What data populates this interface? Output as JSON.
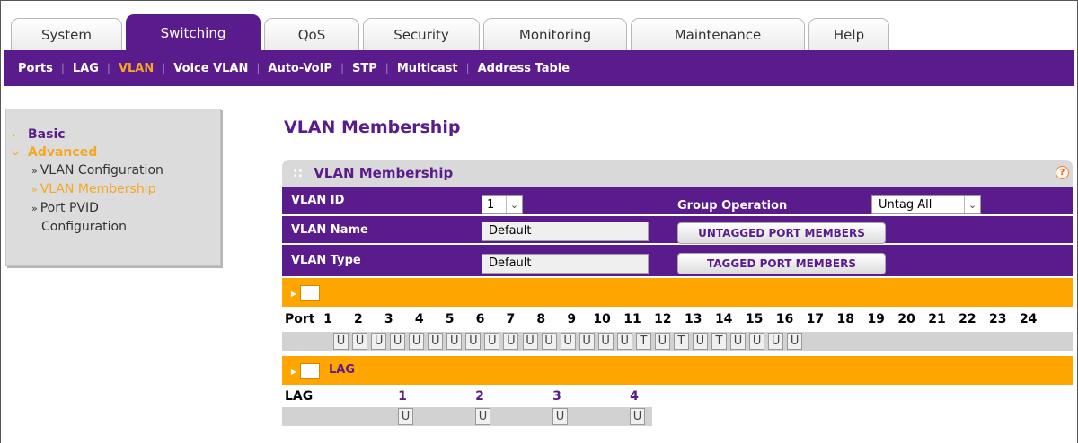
{
  "tabs": [
    {
      "label": "System",
      "active": false
    },
    {
      "label": "Switching",
      "active": true
    },
    {
      "label": "QoS",
      "active": false
    },
    {
      "label": "Security",
      "active": false
    },
    {
      "label": "Monitoring",
      "active": false
    },
    {
      "label": "Maintenance",
      "active": false
    },
    {
      "label": "Help",
      "active": false
    }
  ],
  "subnav": [
    {
      "label": "Ports",
      "active": false
    },
    {
      "label": "LAG",
      "active": false
    },
    {
      "label": "VLAN",
      "active": true
    },
    {
      "label": "Voice VLAN",
      "active": false
    },
    {
      "label": "Auto-VoIP",
      "active": false
    },
    {
      "label": "STP",
      "active": false
    },
    {
      "label": "Multicast",
      "active": false
    },
    {
      "label": "Address Table",
      "active": false
    }
  ],
  "subnav_separator": "|",
  "leftnav": {
    "basic": "Basic",
    "advanced": "Advanced",
    "items": [
      {
        "label": "VLAN Configuration",
        "active": false
      },
      {
        "label": "VLAN Membership",
        "active": true
      },
      {
        "label": "Port PVID",
        "label_cont": "Configuration",
        "active": false
      }
    ],
    "bullet": "»"
  },
  "page_title": "VLAN Membership",
  "panel": {
    "title": "VLAN Membership",
    "dots": "::",
    "help": "?",
    "vlan_id_label": "VLAN ID",
    "vlan_id_value": "1",
    "group_op_label": "Group Operation",
    "group_op_value": "Untag All",
    "vlan_name_label": "VLAN Name",
    "vlan_name_value": "Default",
    "vlan_type_label": "VLAN Type",
    "vlan_type_value": "Default",
    "untagged_btn": "UNTAGGED PORT MEMBERS",
    "tagged_btn": "TAGGED PORT MEMBERS"
  },
  "ports": {
    "label": "Port",
    "numbers": [
      "1",
      "2",
      "3",
      "4",
      "5",
      "6",
      "7",
      "8",
      "9",
      "10",
      "11",
      "12",
      "13",
      "14",
      "15",
      "16",
      "17",
      "18",
      "19",
      "20",
      "21",
      "22",
      "23",
      "24"
    ],
    "states": [
      "U",
      "U",
      "U",
      "U",
      "U",
      "U",
      "U",
      "U",
      "U",
      "U",
      "U",
      "U",
      "U",
      "U",
      "U",
      "U",
      "T",
      "U",
      "T",
      "U",
      "T",
      "U",
      "U",
      "U",
      "U"
    ]
  },
  "lag": {
    "section_title": "LAG",
    "label": "LAG",
    "numbers": [
      "1",
      "2",
      "3",
      "4"
    ],
    "states": [
      "U",
      "U",
      "U",
      "U"
    ]
  },
  "colors": {
    "brand_purple": "#5a1c8d",
    "accent_orange": "#ffa500",
    "active_text": "#f5a623"
  }
}
